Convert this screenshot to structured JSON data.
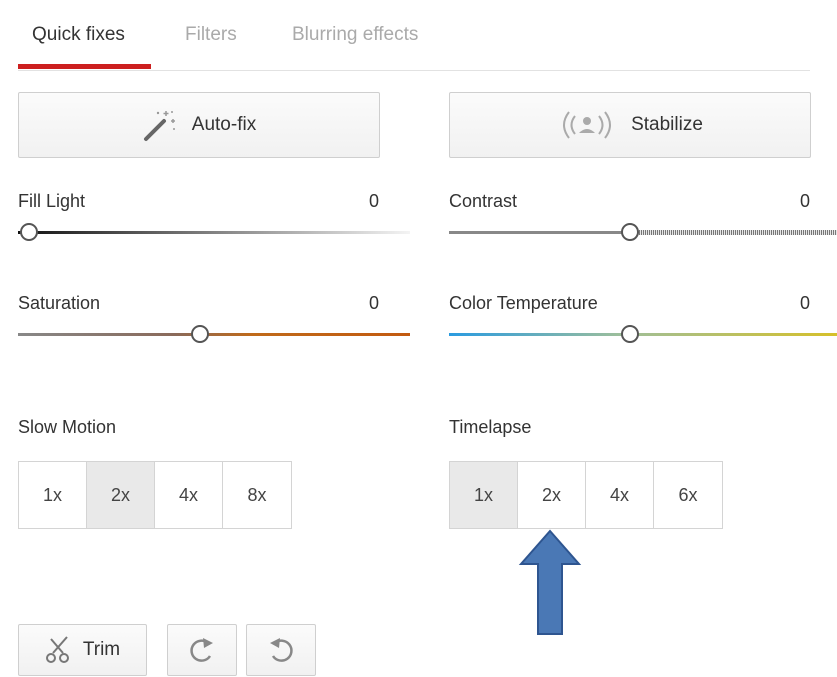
{
  "tabs": [
    {
      "label": "Quick fixes",
      "active": true
    },
    {
      "label": "Filters",
      "active": false
    },
    {
      "label": "Blurring effects",
      "active": false
    }
  ],
  "buttons": {
    "autofix": {
      "label": "Auto-fix",
      "icon": "magic-wand-icon"
    },
    "stabilize": {
      "label": "Stabilize",
      "icon": "stabilize-person-icon"
    }
  },
  "sliders": {
    "fill_light": {
      "label": "Fill Light",
      "value": "0"
    },
    "contrast": {
      "label": "Contrast",
      "value": "0"
    },
    "saturation": {
      "label": "Saturation",
      "value": "0"
    },
    "color_temperature": {
      "label": "Color Temperature",
      "value": "0"
    }
  },
  "slow_motion": {
    "label": "Slow Motion",
    "options": [
      "1x",
      "2x",
      "4x",
      "8x"
    ],
    "selected": "2x"
  },
  "timelapse": {
    "label": "Timelapse",
    "options": [
      "1x",
      "2x",
      "4x",
      "6x"
    ],
    "selected": "1x"
  },
  "bottom": {
    "trim": {
      "label": "Trim",
      "icon": "scissors-icon"
    },
    "rotate_right": {
      "icon": "rotate-clockwise-icon"
    },
    "rotate_left": {
      "icon": "rotate-counterclockwise-icon"
    }
  },
  "colors": {
    "accent": "#cc1f1f",
    "annotation_arrow": "#4a78b5"
  }
}
